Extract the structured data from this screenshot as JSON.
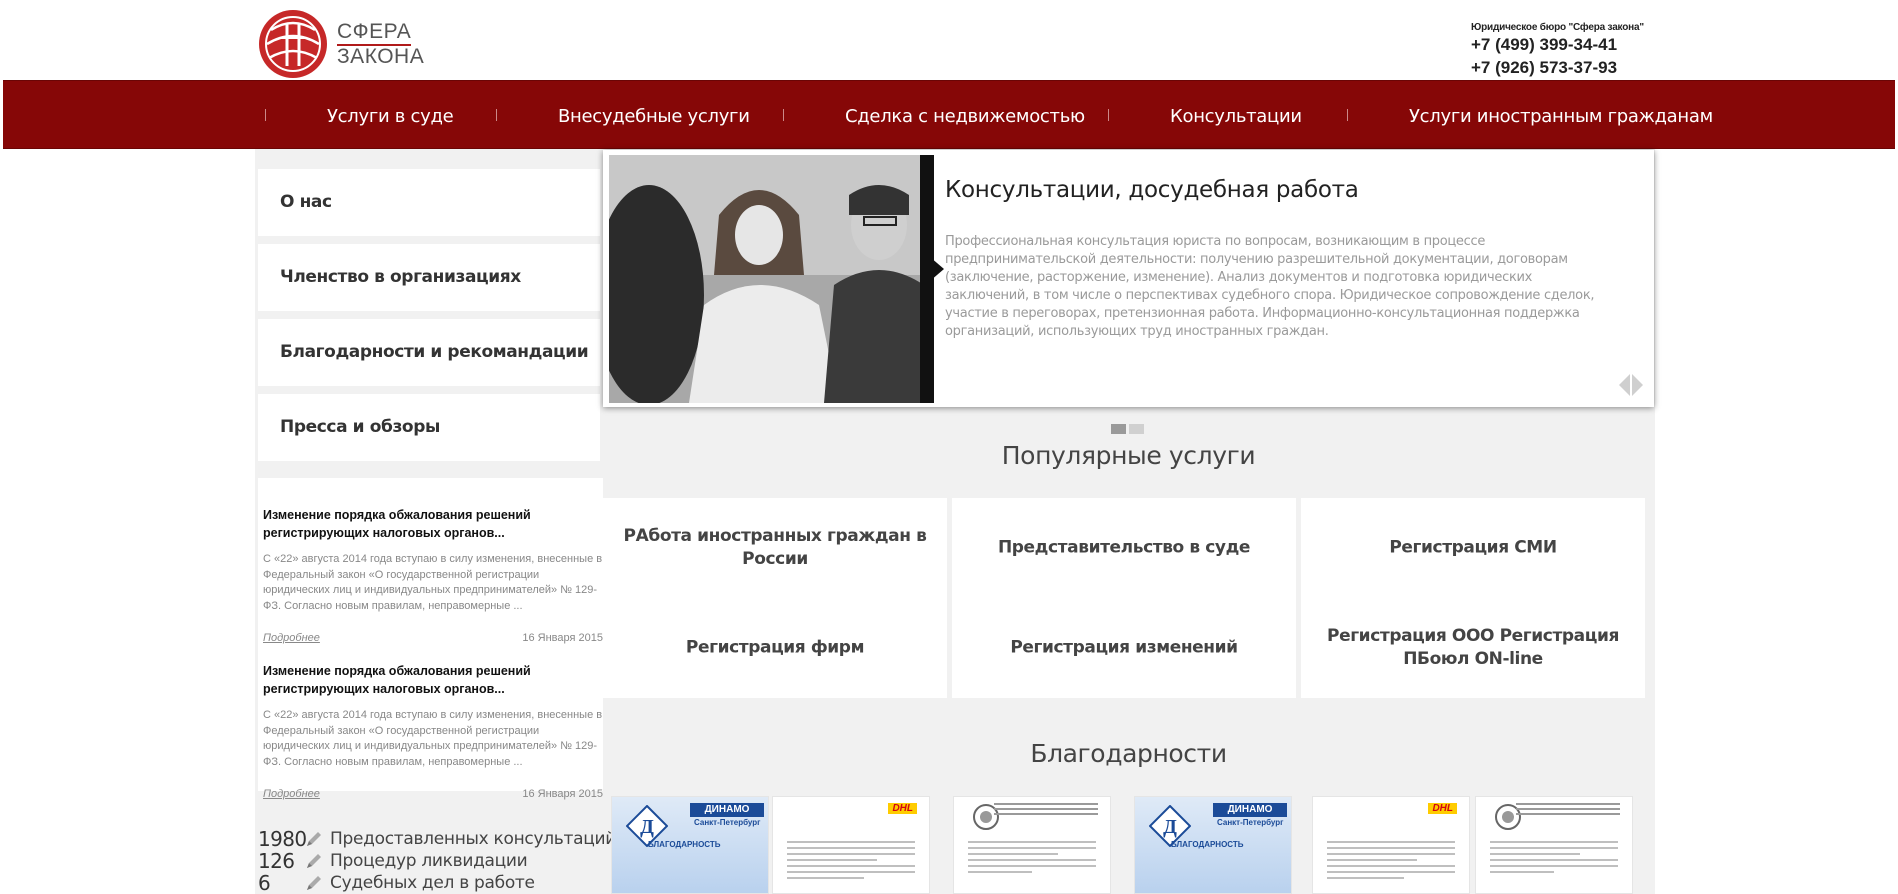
{
  "header": {
    "logo_line1": "СФЕРА",
    "logo_line2": "ЗАКОНА",
    "company": "Юридическое бюро \"Сфера закона\"",
    "phone1": "+7 (499) 399-34-41",
    "phone2": "+7 (926) 573-37-93"
  },
  "nav": {
    "items": [
      {
        "label": "Услуги в суде"
      },
      {
        "label": "Внесудебные услуги"
      },
      {
        "label": "Сделка с недвижемостью"
      },
      {
        "label": "Консультации"
      },
      {
        "label": "Услуги иностранным гражданам"
      }
    ]
  },
  "sidebar": {
    "menu": [
      {
        "label": "О нас"
      },
      {
        "label": "Членство в организациях"
      },
      {
        "label": "Благодарности и рекомандации"
      },
      {
        "label": "Пресса и обзоры"
      }
    ],
    "news": [
      {
        "title": "Изменение порядка обжалования решений регистрирующих налоговых органов...",
        "text": "С «22» августа 2014 года вступаю в силу изменения, внесенные в Федеральный закон «О государственной регистрации юридических лиц и индивидуальных предпринимателей» № 129-ФЗ. Согласно новым правилам, неправомерные ...",
        "more": "Подробнее",
        "date": "16 Января 2015"
      },
      {
        "title": "Изменение порядка обжалования решений регистрирующих налоговых органов...",
        "text": "С «22» августа 2014 года вступаю в силу изменения, внесенные в Федеральный закон «О государственной регистрации юридических лиц и индивидуальных предпринимателей» № 129-ФЗ. Согласно новым правилам, неправомерные ...",
        "more": "Подробнее",
        "date": "16 Января 2015"
      }
    ],
    "stats": [
      {
        "num": "1980",
        "label": "Предоставленных консультаций"
      },
      {
        "num": "126",
        "label": "Процедур ликвидации"
      },
      {
        "num": "6",
        "label": "Судебных дел в работе"
      }
    ]
  },
  "slider": {
    "title": "Консультации, досудебная работа",
    "text": "Профессиональная консультация юриста по вопросам, возникающим в процессе предпринимательской деятельности: получению разрешительной документации, договорам (заключение, расторжение, изменение). Анализ документов и подготовка юридических заключений, в том числе о перспективах судебного спора. Юридическое сопровождение сделок, участие в переговорах, претензионная работа. Информационно-консультационная поддержка организаций, использующих труд иностранных граждан.",
    "slides_total": 2,
    "active_slide": 1
  },
  "popular": {
    "title": "Популярные услуги",
    "services": [
      {
        "label": "РАбота иностранных граждан в России"
      },
      {
        "label": "Представительство в суде"
      },
      {
        "label": "Регистрация СМИ"
      },
      {
        "label": "Регистрация фирм"
      },
      {
        "label": "Регистрация изменений"
      },
      {
        "label": "Регистрация ООО Регистрация ПБоюл ON-line"
      }
    ]
  },
  "thanks": {
    "title": "Благодарности",
    "cards": [
      {
        "type": "dinamo",
        "banner": "ДИНАМО",
        "city": "Санкт-Петербург",
        "caption": "БЛАГОДАРНОСТЬ"
      },
      {
        "type": "dhl",
        "brand": "DHL"
      },
      {
        "type": "emblem"
      },
      {
        "type": "dinamo",
        "banner": "ДИНАМО",
        "city": "Санкт-Петербург",
        "caption": "БЛАГОДАРНОСТЬ"
      },
      {
        "type": "dhl",
        "brand": "DHL"
      },
      {
        "type": "emblem"
      }
    ]
  },
  "colors": {
    "nav_bg": "#860707",
    "accent": "#b01a1a",
    "band_bg": "#f1f1f1"
  }
}
